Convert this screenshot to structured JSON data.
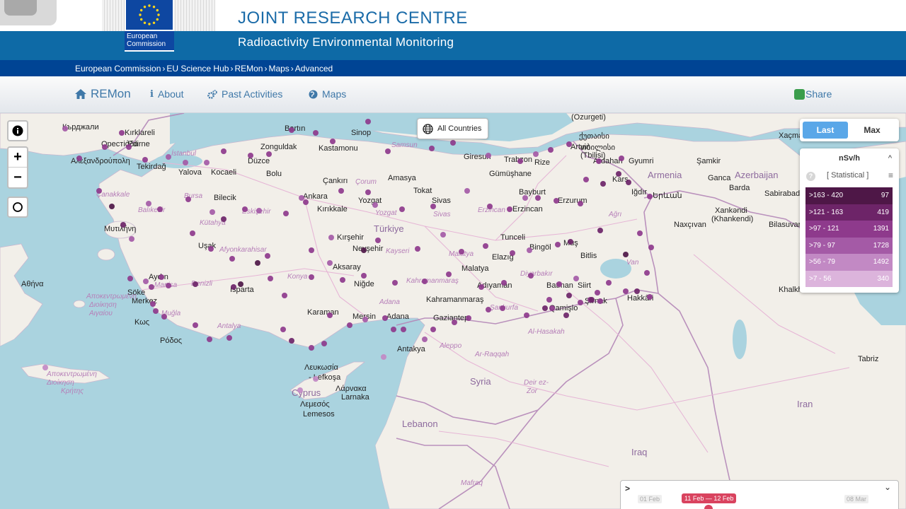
{
  "header": {
    "org_line1": "European",
    "org_line2": "Commission",
    "site_title": "JOINT RESEARCH CENTRE",
    "subtitle": "Radioactivity Environmental Monitoring"
  },
  "breadcrumb": [
    "European Commission",
    "EU Science Hub",
    "REMon",
    "Maps",
    "Advanced"
  ],
  "nav": {
    "brand": "REMon",
    "items": [
      {
        "label": "About",
        "icon": "info-icon"
      },
      {
        "label": "Past Activities",
        "icon": "cogs-icon"
      },
      {
        "label": "Maps",
        "icon": "globe-icon"
      }
    ],
    "share": "Share"
  },
  "map": {
    "all_countries": "All Countries",
    "toggle": {
      "last": "Last",
      "max": "Max",
      "active": "Last"
    },
    "legend": {
      "unit": "nSv/h",
      "mode": "[ Statistical ]",
      "rows": [
        {
          "range": ">163 - 420",
          "count": "97",
          "color": "#4e1747"
        },
        {
          "range": ">121 - 163",
          "count": "419",
          "color": "#6d2468"
        },
        {
          "range": ">97 - 121",
          "count": "1391",
          "color": "#8e3a8c"
        },
        {
          "range": ">79 - 97",
          "count": "1728",
          "color": "#a45aa6"
        },
        {
          "range": ">56 - 79",
          "count": "1492",
          "color": "#c289c4"
        },
        {
          "range": ">7 - 56",
          "count": "340",
          "color": "#dcb4dc"
        }
      ]
    },
    "places": [
      {
        "t": "Кърджали",
        "c": "cap"
      },
      {
        "t": "Kırklareli",
        "c": "cap"
      },
      {
        "t": "Орестіάδα",
        "c": "cap"
      },
      {
        "t": "Edirne",
        "c": "cap"
      },
      {
        "t": "Αλεξανδρούπολη",
        "c": "cap"
      },
      {
        "t": "Tekirdağ",
        "c": "cap"
      },
      {
        "t": "İstanbul",
        "c": "ital"
      },
      {
        "t": "Yalova",
        "c": "cap"
      },
      {
        "t": "Kocaeli",
        "c": "cap"
      },
      {
        "t": "Bartın",
        "c": "cap"
      },
      {
        "t": "Zonguldak",
        "c": "cap"
      },
      {
        "t": "Kastamonu",
        "c": "cap"
      },
      {
        "t": "Düzce",
        "c": "cap"
      },
      {
        "t": "Bolu",
        "c": "cap"
      },
      {
        "t": "Sinop",
        "c": "cap"
      },
      {
        "t": "Samsun",
        "c": "ital"
      },
      {
        "t": "Giresun",
        "c": "cap"
      },
      {
        "t": "Trabzon",
        "c": "cap"
      },
      {
        "t": "Rize",
        "c": "cap"
      },
      {
        "t": "Gümüşhane",
        "c": "cap"
      },
      {
        "t": "Artvin",
        "c": "cap"
      },
      {
        "t": "(Ozurgeti)",
        "c": "cap"
      },
      {
        "t": "ქუთაისი",
        "c": "cap"
      },
      {
        "t": "თბილისი",
        "c": "cap"
      },
      {
        "t": "(Tbilisi)",
        "c": "cap"
      },
      {
        "t": "Ardahan",
        "c": "cap"
      },
      {
        "t": "Gyumri",
        "c": "cap"
      },
      {
        "t": "Armenia",
        "c": "country"
      },
      {
        "t": "Azerbaijan",
        "c": "country"
      },
      {
        "t": "Şamkir",
        "c": "cap"
      },
      {
        "t": "Ganca",
        "c": "cap"
      },
      {
        "t": "Barda",
        "c": "cap"
      },
      {
        "t": "Sabirabad",
        "c": "cap"
      },
      {
        "t": "Xankəndi",
        "c": "cap"
      },
      {
        "t": "(Khankendi)",
        "c": "cap"
      },
      {
        "t": "Bilasuvar",
        "c": "cap"
      },
      {
        "t": "Xaçmaz",
        "c": "cap"
      },
      {
        "t": "Kars",
        "c": "cap"
      },
      {
        "t": "Iğdır",
        "c": "cap"
      },
      {
        "t": "Երևան",
        "c": "cap"
      },
      {
        "t": "Naxçıvan",
        "c": "cap"
      },
      {
        "t": "Çankırı",
        "c": "cap"
      },
      {
        "t": "Çorum",
        "c": "ital"
      },
      {
        "t": "Amasya",
        "c": "cap"
      },
      {
        "t": "Tokat",
        "c": "cap"
      },
      {
        "t": "Bayburt",
        "c": "cap"
      },
      {
        "t": "Erzurum",
        "c": "cap"
      },
      {
        "t": "Erzincan",
        "c": "cap"
      },
      {
        "t": "Erzincan",
        "c": "ital"
      },
      {
        "t": "Ağrı",
        "c": "ital"
      },
      {
        "t": "Çanakkale",
        "c": "ital"
      },
      {
        "t": "Bursa",
        "c": "ital"
      },
      {
        "t": "Bilecik",
        "c": "cap"
      },
      {
        "t": "Balıkesir",
        "c": "ital"
      },
      {
        "t": "Eskişehir",
        "c": "ital"
      },
      {
        "t": "Ankara",
        "c": "cap"
      },
      {
        "t": "Kırıkkale",
        "c": "cap"
      },
      {
        "t": "Yozgat",
        "c": "cap"
      },
      {
        "t": "Yozgat",
        "c": "ital"
      },
      {
        "t": "Sivas",
        "c": "cap"
      },
      {
        "t": "Sivas",
        "c": "ital"
      },
      {
        "t": "Türkiye",
        "c": "country"
      },
      {
        "t": "Tunceli",
        "c": "cap"
      },
      {
        "t": "Bingöl",
        "c": "cap"
      },
      {
        "t": "Muş",
        "c": "cap"
      },
      {
        "t": "Bitlis",
        "c": "cap"
      },
      {
        "t": "Van",
        "c": "ital"
      },
      {
        "t": "Μυτιλήνη",
        "c": "cap"
      },
      {
        "t": "Kütahya",
        "c": "ital"
      },
      {
        "t": "Kırşehir",
        "c": "cap"
      },
      {
        "t": "Nevşehir",
        "c": "cap"
      },
      {
        "t": "Kayseri",
        "c": "ital"
      },
      {
        "t": "Malatya",
        "c": "ital"
      },
      {
        "t": "Malatya",
        "c": "cap"
      },
      {
        "t": "Elazığ",
        "c": "cap"
      },
      {
        "t": "Diyarbakır",
        "c": "ital"
      },
      {
        "t": "Batman",
        "c": "cap"
      },
      {
        "t": "Siirt",
        "c": "cap"
      },
      {
        "t": "Hakkâri",
        "c": "cap"
      },
      {
        "t": "Manisa",
        "c": "ital"
      },
      {
        "t": "Uşak",
        "c": "cap"
      },
      {
        "t": "Afyonkarahisar",
        "c": "ital"
      },
      {
        "t": "Aksaray",
        "c": "cap"
      },
      {
        "t": "Niğde",
        "c": "cap"
      },
      {
        "t": "Kahramanmaraş",
        "c": "ital"
      },
      {
        "t": "Adıyaman",
        "c": "cap"
      },
      {
        "t": "Kahramanmaraş",
        "c": "cap"
      },
      {
        "t": "Şanlıurfa",
        "c": "ital"
      },
      {
        "t": "Qamişlo",
        "c": "cap"
      },
      {
        "t": "Şırnak",
        "c": "cap"
      },
      {
        "t": "Aydın",
        "c": "cap"
      },
      {
        "t": "Denizli",
        "c": "ital"
      },
      {
        "t": "Konya",
        "c": "ital"
      },
      {
        "t": "Isparta",
        "c": "cap"
      },
      {
        "t": "Söke",
        "c": "cap"
      },
      {
        "t": "Merkez",
        "c": "cap"
      },
      {
        "t": "Muğla",
        "c": "ital"
      },
      {
        "t": "Karaman",
        "c": "cap"
      },
      {
        "t": "Adana",
        "c": "ital"
      },
      {
        "t": "Mersin",
        "c": "cap"
      },
      {
        "t": "Adana",
        "c": "cap"
      },
      {
        "t": "Gaziantep",
        "c": "cap"
      },
      {
        "t": "Antalya",
        "c": "ital"
      },
      {
        "t": "Αθήνα",
        "c": "cap"
      },
      {
        "t": "Αποκεντρωμένη",
        "c": "ital"
      },
      {
        "t": "Διοίκηση",
        "c": "ital"
      },
      {
        "t": "Αιγαίου",
        "c": "ital"
      },
      {
        "t": "Κως",
        "c": "cap"
      },
      {
        "t": "Ρόδος",
        "c": "cap"
      },
      {
        "t": "Αποκεντρωμένη",
        "c": "ital"
      },
      {
        "t": "Διοίκηση",
        "c": "ital"
      },
      {
        "t": "Κρήτης",
        "c": "ital"
      },
      {
        "t": "Λευκωσία",
        "c": "cap"
      },
      {
        "t": "- Lefkoşa",
        "c": "cap"
      },
      {
        "t": "Cyprus",
        "c": "country"
      },
      {
        "t": "Λάρνακα",
        "c": "cap"
      },
      {
        "t": "Larnaka",
        "c": "cap"
      },
      {
        "t": "Λεμεσός",
        "c": "cap"
      },
      {
        "t": "Lemesos",
        "c": "cap"
      },
      {
        "t": "Antakya",
        "c": "cap"
      },
      {
        "t": "Aleppo",
        "c": "ital"
      },
      {
        "t": "Ar-Raqqah",
        "c": "ital"
      },
      {
        "t": "Al-Hasakah",
        "c": "ital"
      },
      {
        "t": "Syria",
        "c": "country"
      },
      {
        "t": "Deir ez-",
        "c": "ital"
      },
      {
        "t": "Zor",
        "c": "ital"
      },
      {
        "t": "Lebanon",
        "c": "country"
      },
      {
        "t": "Iraq",
        "c": "country"
      },
      {
        "t": "Iran",
        "c": "country"
      },
      {
        "t": "Mafraq",
        "c": "ital"
      },
      {
        "t": "Khalkhal",
        "c": "cap"
      },
      {
        "t": "Tabriz",
        "c": "cap"
      }
    ],
    "stations": [],
    "timeline": {
      "start": "01 Feb",
      "range": "11 Feb — 12 Feb",
      "end": "08 Mar"
    }
  }
}
